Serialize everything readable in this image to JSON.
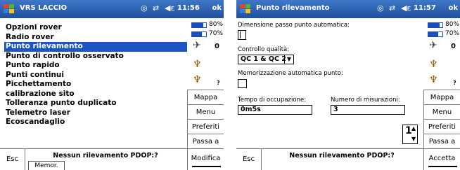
{
  "left": {
    "title": "VRS LACCIO",
    "clock": "11:56",
    "ok": "ok",
    "menu_items": [
      "Opzioni rover",
      "Radio rover",
      "Punto rilevamento",
      "Punto di controllo osservato",
      "Punto rapido",
      "Punti continui",
      "Picchettamento",
      "calibrazione sito",
      "Tolleranza punto duplicato",
      "Telemetro laser",
      "Ecoscandaglio"
    ],
    "selected_index": 2,
    "battery": [
      {
        "label": "80%",
        "level": 0.8
      },
      {
        "label": "70%",
        "level": 0.7
      }
    ],
    "sat_count": "0",
    "unknown_mark": "?",
    "side_buttons": [
      "Mappa",
      "Menu",
      "Preferiti",
      "Passa a"
    ],
    "esc": "Esc",
    "status": "Nessun rilevamento PDOP:?",
    "memor": "Memor.",
    "action": "Modifica"
  },
  "right": {
    "title": "Punto rilevamento",
    "clock": "11:57",
    "ok": "ok",
    "lbl_dimensione": "Dimensione passo punto automatica:",
    "val_dimensione": "",
    "lbl_controllo": "Controllo qualità:",
    "val_controllo": "QC 1 & QC 2",
    "lbl_memorizzazione": "Memorizzazione automatica punto:",
    "lbl_tempo": "Tempo di occupazione:",
    "val_tempo": "0m5s",
    "lbl_numero": "Numero di misurazioni:",
    "val_numero": "3",
    "spin_value": "1",
    "battery": [
      {
        "label": "80%",
        "level": 0.8
      },
      {
        "label": "70%",
        "level": 0.7
      }
    ],
    "sat_count": "0",
    "unknown_mark": "?",
    "side_buttons": [
      "Mappa",
      "Menu",
      "Preferiti",
      "Passa a"
    ],
    "esc": "Esc",
    "status": "Nessun rilevamento PDOP:?",
    "action": "Accetta"
  },
  "icons": {
    "windows_logo": "windows-flag-icon",
    "gps": "gps-icon",
    "sync": "sync-icon",
    "speaker": "speaker-icon",
    "satellite": "satellite-icon",
    "radio": "radio-antenna-icon"
  },
  "colors": {
    "titlebar": "#2a5fb0",
    "selection": "#1c56c4",
    "battery": "#1a4fb8"
  }
}
